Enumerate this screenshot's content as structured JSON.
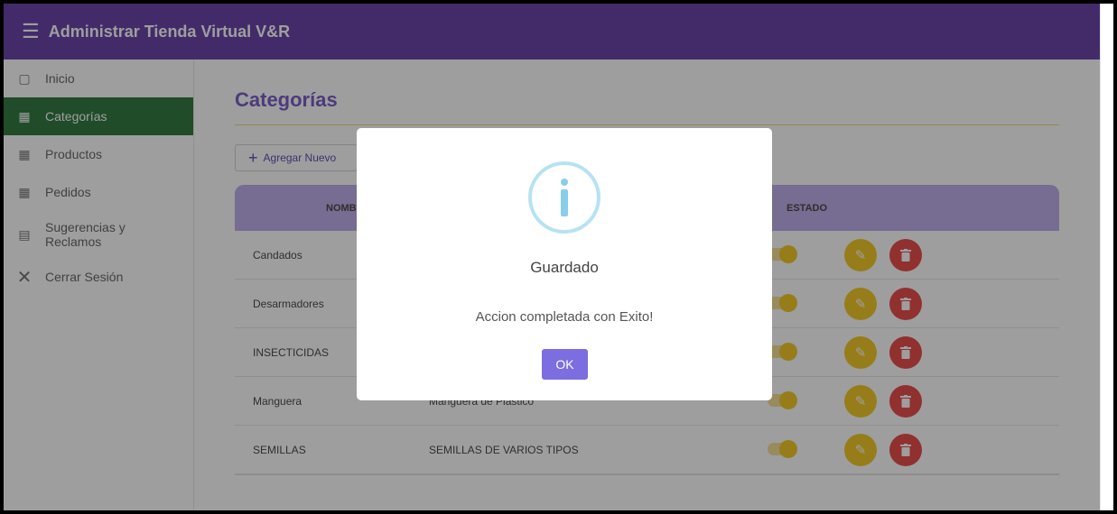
{
  "header": {
    "title": "Administrar Tienda Virtual V&R",
    "menu_icon": "hamburger-icon",
    "bg_color": "#5a2ea0"
  },
  "sidebar": {
    "items": [
      {
        "label": "Inicio",
        "icon": "monitor-icon",
        "active": false
      },
      {
        "label": "Categorías",
        "icon": "table-icon",
        "active": true
      },
      {
        "label": "Productos",
        "icon": "clipboard-icon",
        "active": false
      },
      {
        "label": "Pedidos",
        "icon": "cart-icon",
        "active": false
      },
      {
        "label": "Sugerencias y\nReclamos",
        "icon": "chart-icon",
        "active": false
      },
      {
        "label": "Cerrar Sesión",
        "icon": "close-icon",
        "active": false
      }
    ]
  },
  "main": {
    "page_title": "Categorías",
    "add_button_label": "Agregar Nuevo",
    "table": {
      "headers": [
        "NOMBRE",
        "ESTADO"
      ],
      "rows": [
        {
          "name": "Candados",
          "description": ""
        },
        {
          "name": "Desarmadores",
          "description": ""
        },
        {
          "name": "INSECTICIDAS",
          "description": ""
        },
        {
          "name": "Manguera",
          "description": "Manguera de Plastico"
        },
        {
          "name": "SEMILLAS",
          "description": "SEMILLAS DE VARIOS TIPOS"
        }
      ]
    }
  },
  "modal": {
    "icon": "info-icon",
    "title": "Guardado",
    "message": "Accion completada con Exito!",
    "ok_label": "OK"
  }
}
